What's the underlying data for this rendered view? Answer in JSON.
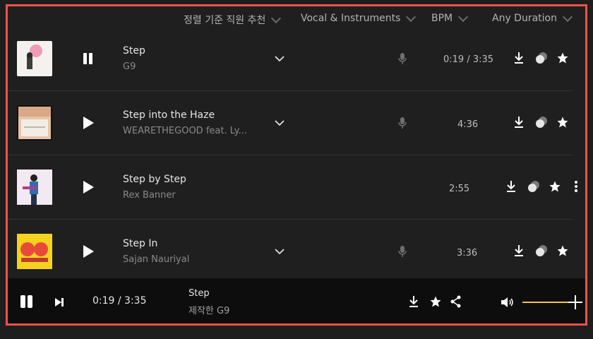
{
  "filters": {
    "sort": "정렬 기준 직원 추천",
    "vocal": "Vocal & Instruments",
    "bpm": "BPM",
    "duration": "Any Duration"
  },
  "tracks": [
    {
      "title": "Step",
      "artist": "G9",
      "time": "0:19 / 3:35",
      "state": "pause"
    },
    {
      "title": "Step into the Haze",
      "artist": "WEARETHEGOOD feat. Ly...",
      "time": "4:36",
      "state": "play"
    },
    {
      "title": "Step by Step",
      "artist": "Rex Banner",
      "time": "2:55",
      "state": "play"
    },
    {
      "title": "Step In",
      "artist": "Sajan Nauriyal",
      "time": "3:36",
      "state": "play"
    }
  ],
  "player": {
    "time": "0:19 / 3:35",
    "title": "Step",
    "subtitle": "제작한 G9",
    "volume": 1.0
  },
  "colors": {
    "frame": "#f0524c",
    "volume_bar": "#f0c64a"
  }
}
